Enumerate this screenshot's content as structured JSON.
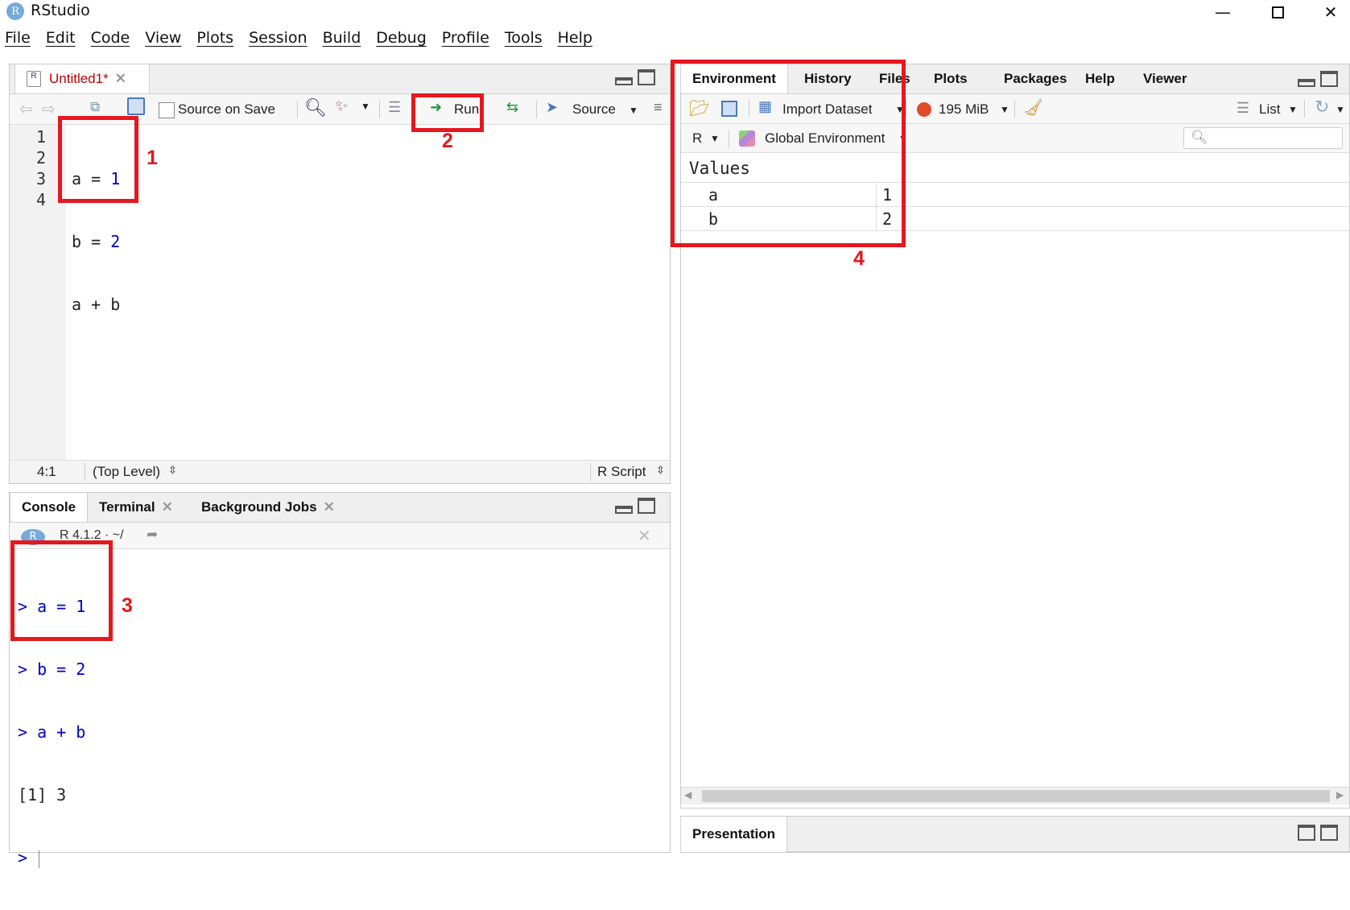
{
  "window": {
    "title": "RStudio",
    "logo": "R"
  },
  "menu": [
    "File",
    "Edit",
    "Code",
    "View",
    "Plots",
    "Session",
    "Build",
    "Debug",
    "Profile",
    "Tools",
    "Help"
  ],
  "editor": {
    "tab_label": "Untitled1*",
    "source_on_save": "Source on Save",
    "run_label": "Run",
    "source_label": "Source",
    "line_numbers": [
      "1",
      "2",
      "3",
      "4"
    ],
    "code": [
      {
        "l": "a",
        "op": "=",
        "r": "1"
      },
      {
        "l": "b",
        "op": "=",
        "r": "2"
      },
      {
        "l": "a",
        "op": "+",
        "r": "b"
      }
    ],
    "status_pos": "4:1",
    "status_scope": "(Top Level)",
    "status_type": "R Script"
  },
  "console": {
    "tabs": [
      "Console",
      "Terminal",
      "Background Jobs"
    ],
    "r_version": "R 4.1.2 · ~/",
    "lines": [
      {
        "prompt": ">",
        "text": "a = 1"
      },
      {
        "prompt": ">",
        "text": "b = 2"
      },
      {
        "prompt": ">",
        "text": "a + b"
      }
    ],
    "output": "[1] 3",
    "prompt": ">"
  },
  "environment": {
    "tabs": [
      "Environment",
      "History",
      "Files",
      "Plots",
      "Packages",
      "Help",
      "Viewer"
    ],
    "import_dataset": "Import Dataset",
    "memory": "195 MiB",
    "list_label": "List",
    "lang": "R",
    "scope": "Global Environment",
    "section": "Values",
    "values": [
      {
        "name": "a",
        "value": "1"
      },
      {
        "name": "b",
        "value": "2"
      }
    ]
  },
  "presentation": {
    "tab": "Presentation"
  },
  "annotations": [
    "1",
    "2",
    "3",
    "4"
  ],
  "colors": {
    "annotation": "#e5171f",
    "code_number": "#0000cc"
  }
}
